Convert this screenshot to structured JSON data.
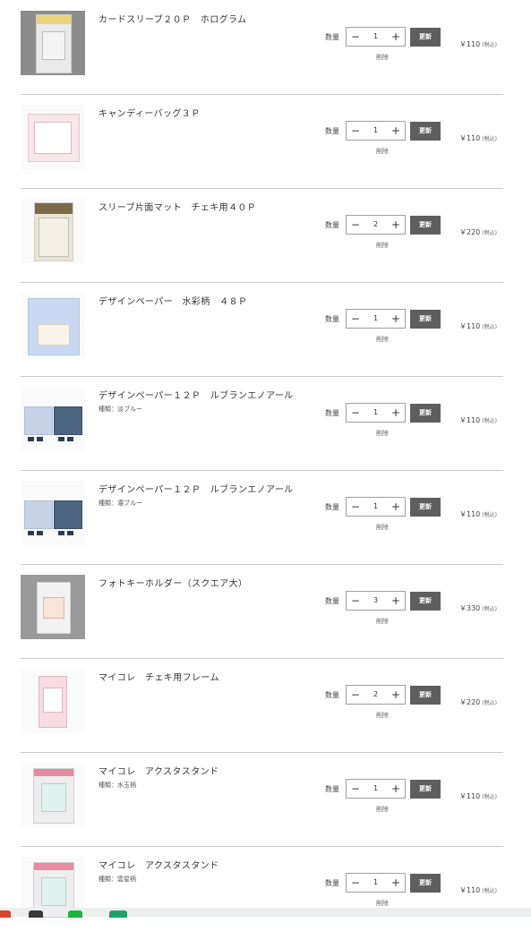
{
  "cart": {
    "items": [
      {
        "name": "カードスリーブ２０Ｐ　ホログラム",
        "variant": "",
        "qty_label": "数量",
        "qty": "1",
        "update_label": "更新",
        "delete_label": "削除",
        "price": "￥110",
        "tax": "(税込)"
      },
      {
        "name": "キャンディーバッグ３Ｐ",
        "variant": "",
        "qty_label": "数量",
        "qty": "1",
        "update_label": "更新",
        "delete_label": "削除",
        "price": "￥110",
        "tax": "(税込)"
      },
      {
        "name": "スリーブ片面マット　チェキ用４０Ｐ",
        "variant": "",
        "qty_label": "数量",
        "qty": "2",
        "update_label": "更新",
        "delete_label": "削除",
        "price": "￥220",
        "tax": "(税込)"
      },
      {
        "name": "デザインペーパー　水彩柄　４８Ｐ",
        "variant": "",
        "qty_label": "数量",
        "qty": "1",
        "update_label": "更新",
        "delete_label": "削除",
        "price": "￥110",
        "tax": "(税込)"
      },
      {
        "name": "デザインペーパー１２Ｐ　ルブランエノアール",
        "variant": "種類：淡ブルー",
        "qty_label": "数量",
        "qty": "1",
        "update_label": "更新",
        "delete_label": "削除",
        "price": "￥110",
        "tax": "(税込)"
      },
      {
        "name": "デザインペーパー１２Ｐ　ルブランエノアール",
        "variant": "種類：濃ブルー",
        "qty_label": "数量",
        "qty": "1",
        "update_label": "更新",
        "delete_label": "削除",
        "price": "￥110",
        "tax": "(税込)"
      },
      {
        "name": "フォトキーホルダー（スクエア大）",
        "variant": "",
        "qty_label": "数量",
        "qty": "3",
        "update_label": "更新",
        "delete_label": "削除",
        "price": "￥330",
        "tax": "(税込)"
      },
      {
        "name": "マイコレ　チェキ用フレーム",
        "variant": "",
        "qty_label": "数量",
        "qty": "2",
        "update_label": "更新",
        "delete_label": "削除",
        "price": "￥220",
        "tax": "(税込)"
      },
      {
        "name": "マイコレ　アクスタスタンド",
        "variant": "種類：水玉柄",
        "qty_label": "数量",
        "qty": "1",
        "update_label": "更新",
        "delete_label": "削除",
        "price": "￥110",
        "tax": "(税込)"
      },
      {
        "name": "マイコレ　アクスタスタンド",
        "variant": "種類：雲星柄",
        "qty_label": "数量",
        "qty": "1",
        "update_label": "更新",
        "delete_label": "削除",
        "price": "￥110",
        "tax": "(税込)"
      }
    ],
    "minus_symbol": "−",
    "plus_symbol": "+"
  },
  "colors": {
    "update_button": "#5e5e5e",
    "divider": "#c9c9c9",
    "text": "#333333"
  }
}
